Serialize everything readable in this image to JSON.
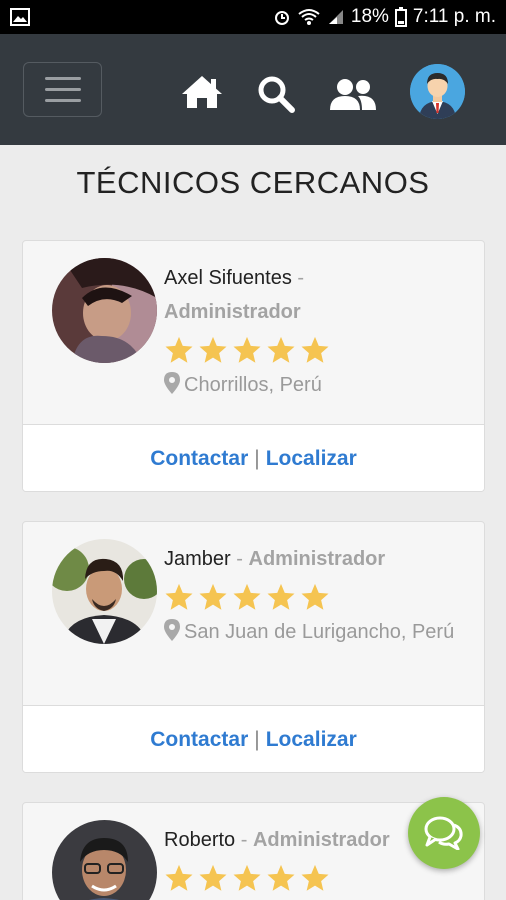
{
  "status_bar": {
    "battery": "18%",
    "time": "7:11 p. m."
  },
  "header": {
    "menu_icon": "hamburger-icon",
    "icons": [
      "home-icon",
      "search-icon",
      "users-icon",
      "profile-avatar"
    ]
  },
  "page": {
    "title": "TÉCNICOS CERCANOS"
  },
  "technicians": [
    {
      "name": "Axel Sifuentes",
      "separator": "-",
      "role": "Administrador",
      "rating": 5,
      "location": "Chorrillos, Perú",
      "contact_label": "Contactar",
      "divider": "|",
      "locate_label": "Localizar"
    },
    {
      "name": "Jamber",
      "separator": "-",
      "role": "Administrador",
      "rating": 5,
      "location": "San Juan de Lurigancho, Perú",
      "contact_label": "Contactar",
      "divider": "|",
      "locate_label": "Localizar"
    },
    {
      "name": "Roberto",
      "separator": "-",
      "role": "Administrador",
      "rating": 5
    }
  ],
  "colors": {
    "topbar": "#343a40",
    "link": "#2f7bd1",
    "star": "#f5c451",
    "fab": "#8cc34a"
  },
  "fab": {
    "icon": "chat-bubbles-icon"
  }
}
